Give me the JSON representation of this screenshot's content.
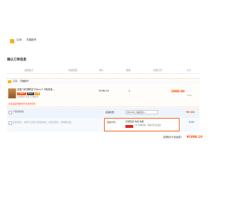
{
  "store_bar": {
    "label": "店铺：",
    "name": "天猫超市"
  },
  "confirm_title": "确认订单信息",
  "columns": [
    "店铺宝贝",
    "商品属性",
    "单价",
    "数量",
    "优惠方式",
    "小计"
  ],
  "shop": {
    "label": "店铺：",
    "name": "天猫超市"
  },
  "item": {
    "title": "雀巢飞利浦联名750ml 7.0吨真素…",
    "badges": [
      "天猫超市",
      "极速达",
      "包邮"
    ],
    "subtitle": "全球精选 雀巢 天猫超市",
    "price": "1998.00",
    "qty": "1",
    "subtotal": "1998.00",
    "weight": "3.0kg",
    "note": "此商品由天猫超市为您提供配送"
  },
  "coupon": {
    "checkbox_label": "不使用促销",
    "promo_label": "店铺优惠：",
    "promo_value": "省99.90元:满减活动 ∨",
    "promo_amount": "-99.90"
  },
  "message": {
    "label": "给商家留言：请填写与商家已协商的内容，1位是运营商，大牌预售商品"
  },
  "shipping": {
    "label": "运送方式：",
    "method": "普通配送 快递 免邮",
    "tmall_badge": "天猫速递",
    "promise": "15:30前付款，承诺1月2日送达",
    "amount": "0.00"
  },
  "total": {
    "label": "店铺合计(含运费)",
    "amount": "¥1898.10"
  },
  "colors": {
    "accent": "#ff4400",
    "border_accent": "#f06a26"
  }
}
